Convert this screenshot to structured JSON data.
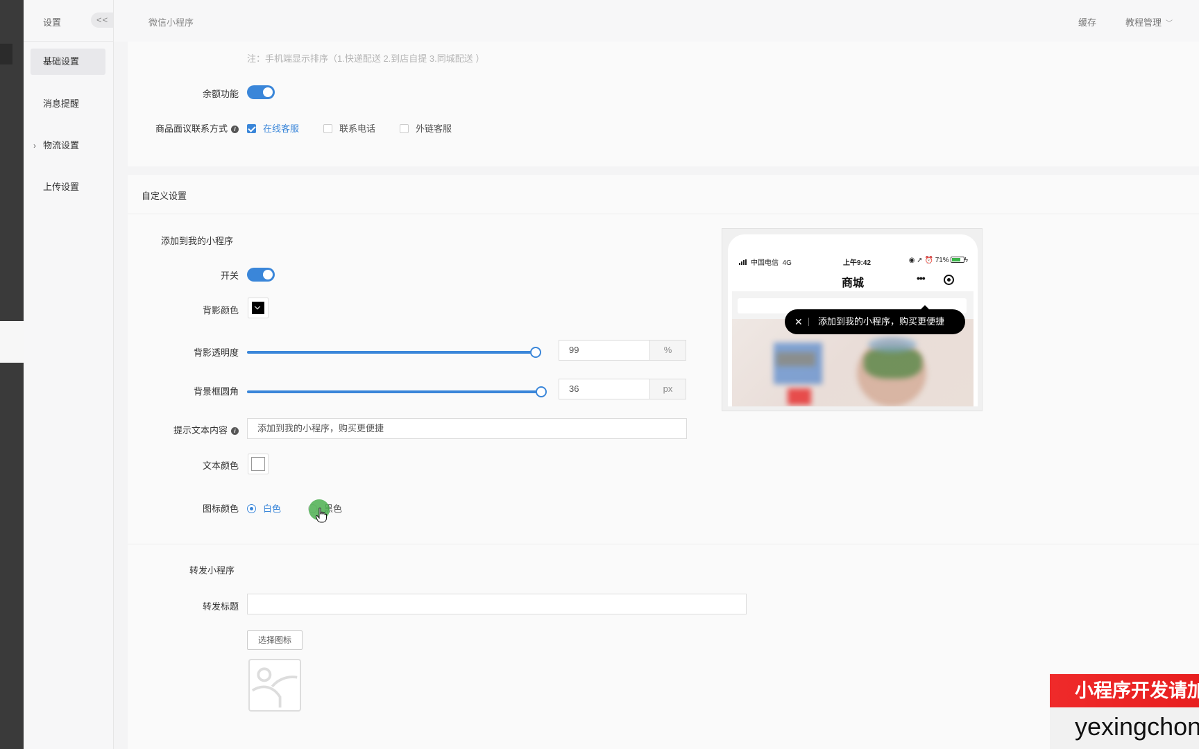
{
  "sidebar": {
    "title": "设置",
    "collapse_label": "<<",
    "items": [
      {
        "label": "基础设置"
      },
      {
        "label": "消息提醒"
      },
      {
        "label": "物流设置"
      },
      {
        "label": "上传设置"
      }
    ]
  },
  "topbar": {
    "breadcrumb": "微信小程序",
    "cache": "缓存",
    "tutorial": "教程管理"
  },
  "section_basic": {
    "note": "注：手机端显示排序（1.快递配送 2.到店自提 3.同城配送 ）",
    "balance_label": "余额功能",
    "balance_on": true,
    "contact_label": "商品面议联系方式",
    "contact_options": [
      {
        "label": "在线客服",
        "checked": true
      },
      {
        "label": "联系电话",
        "checked": false
      },
      {
        "label": "外链客服",
        "checked": false
      }
    ]
  },
  "section_custom": {
    "title": "自定义设置",
    "add_mini": {
      "subtitle": "添加到我的小程序",
      "switch_label": "开关",
      "switch_on": true,
      "bg_color_label": "背影颜色",
      "bg_color": "#000000",
      "opacity_label": "背影透明度",
      "opacity_value": "99",
      "opacity_unit": "%",
      "opacity_fraction": 0.99,
      "radius_label": "背景框圆角",
      "radius_value": "36",
      "radius_unit": "px",
      "radius_fraction": 1.0,
      "hint_label": "提示文本内容",
      "hint_value": "添加到我的小程序，购买更便捷",
      "text_color_label": "文本颜色",
      "text_color": "#ffffff",
      "icon_color_label": "图标颜色",
      "icon_options": [
        {
          "label": "白色",
          "selected": true
        },
        {
          "label": "黑色",
          "selected": false
        }
      ]
    },
    "share": {
      "subtitle": "转发小程序",
      "title_label": "转发标题",
      "title_value": "",
      "choose_icon": "选择图标"
    }
  },
  "preview": {
    "carrier": "中国电信",
    "network": "4G",
    "time": "上午9:42",
    "battery": "71%",
    "nav_title": "商城",
    "tooltip_text": "添加到我的小程序，购买更便捷"
  },
  "overlay": {
    "ad_line1": "小程序开发请加",
    "ad_line2": "yexingchon"
  },
  "colors": {
    "accent": "#3a86d9",
    "ad_red": "#e81f1f"
  }
}
